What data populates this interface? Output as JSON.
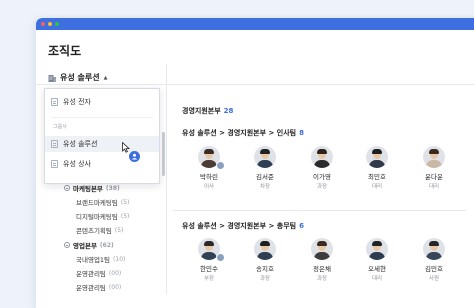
{
  "app": {
    "accent": "#3d6fe0",
    "title": "조직도"
  },
  "org_selector": {
    "label": "유성 솔루션",
    "icon": "building-icon"
  },
  "dropdown": {
    "items_top": [
      {
        "label": "유성 전자"
      }
    ],
    "group_label": "그룹사",
    "items_group": [
      {
        "label": "유성 솔루션"
      },
      {
        "label": "유성 상사"
      }
    ]
  },
  "tree": [
    {
      "label": "마케팅본부",
      "count": "(38)",
      "bold": true,
      "toggle": true
    },
    {
      "label": "브랜드마케팅팀",
      "count": "(5)"
    },
    {
      "label": "디지털마케팅팀",
      "count": "(5)"
    },
    {
      "label": "콘텐츠기획팀",
      "count": "(5)"
    },
    {
      "label": "영업본부",
      "count": "(62)",
      "bold": true,
      "toggle": true
    },
    {
      "label": "국내영업1팀",
      "count": "(10)"
    },
    {
      "label": "운영관리팀",
      "count": "(00)"
    },
    {
      "label": "운영관리팀",
      "count": "(00)"
    }
  ],
  "main": {
    "header": {
      "title": "경영지원본부",
      "count": "28"
    },
    "sections": [
      {
        "path": "유성 솔루션 > 경영지원본부 > 인사팀",
        "count": "8",
        "people": [
          {
            "name": "박하린",
            "role": "이사",
            "hair": "#3a2c22",
            "shirt": "#4b3c35",
            "badge": true
          },
          {
            "name": "김서준",
            "role": "차장",
            "hair": "#222222",
            "shirt": "#2f3f55",
            "badge": false
          },
          {
            "name": "이가영",
            "role": "과장",
            "hair": "#2d241f",
            "shirt": "#2b2b2b",
            "badge": false
          },
          {
            "name": "최민호",
            "role": "대리",
            "hair": "#1f1f1f",
            "shirt": "#31394a",
            "badge": false
          },
          {
            "name": "윤다운",
            "role": "대리",
            "hair": "#3b2a20",
            "shirt": "#c9b8a6",
            "badge": false
          }
        ]
      },
      {
        "path": "유성 솔루션 > 경영지원본부 > 총무팀",
        "count": "6",
        "people": [
          {
            "name": "한민수",
            "role": "부장",
            "hair": "#2a2a2a",
            "shirt": "#334155",
            "badge": true
          },
          {
            "name": "송지호",
            "role": "과장",
            "hair": "#1f1f1f",
            "shirt": "#2f3e52",
            "badge": false
          },
          {
            "name": "정은채",
            "role": "과장",
            "hair": "#3a2a22",
            "shirt": "#3d3d3d",
            "badge": false
          },
          {
            "name": "오세현",
            "role": "대리",
            "hair": "#222222",
            "shirt": "#2e3a4d",
            "badge": false
          },
          {
            "name": "김민호",
            "role": "사원",
            "hair": "#262626",
            "shirt": "#39465a",
            "badge": false
          }
        ]
      }
    ]
  }
}
